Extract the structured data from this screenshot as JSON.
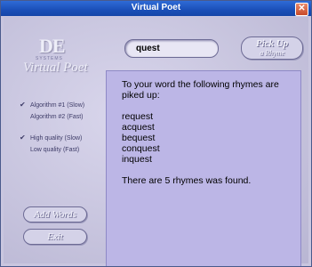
{
  "window": {
    "title": "Virtual Poet",
    "close_glyph": "✕"
  },
  "logo": {
    "mark": "DE",
    "subtitle": "SYSTEMS",
    "app_name": "Virtual Poet"
  },
  "search": {
    "value": "quest"
  },
  "pick_button": {
    "line1": "Pick Up",
    "line2": "a Rhyme"
  },
  "algorithms": [
    {
      "label": "Algorithm #1 (Slow)",
      "checked": true
    },
    {
      "label": "Algorithm #2 (Fast)",
      "checked": false
    }
  ],
  "quality": [
    {
      "label": "High quality (Slow)",
      "checked": true
    },
    {
      "label": "Low quality (Fast)",
      "checked": false
    }
  ],
  "check_glyph": "✔",
  "buttons": {
    "add_words": "Add Words",
    "exit": "Exit"
  },
  "output": {
    "intro_line1": "To your word the following rhymes are",
    "intro_line2": "piked up:",
    "rhymes": [
      "request",
      "acquest",
      "bequest",
      "conquest",
      "inquest"
    ],
    "summary": "There are 5 rhymes was found."
  },
  "colors": {
    "titlebar": "#1a4fb8",
    "background": "#c9c6df",
    "output_panel": "#bcb6e6"
  }
}
